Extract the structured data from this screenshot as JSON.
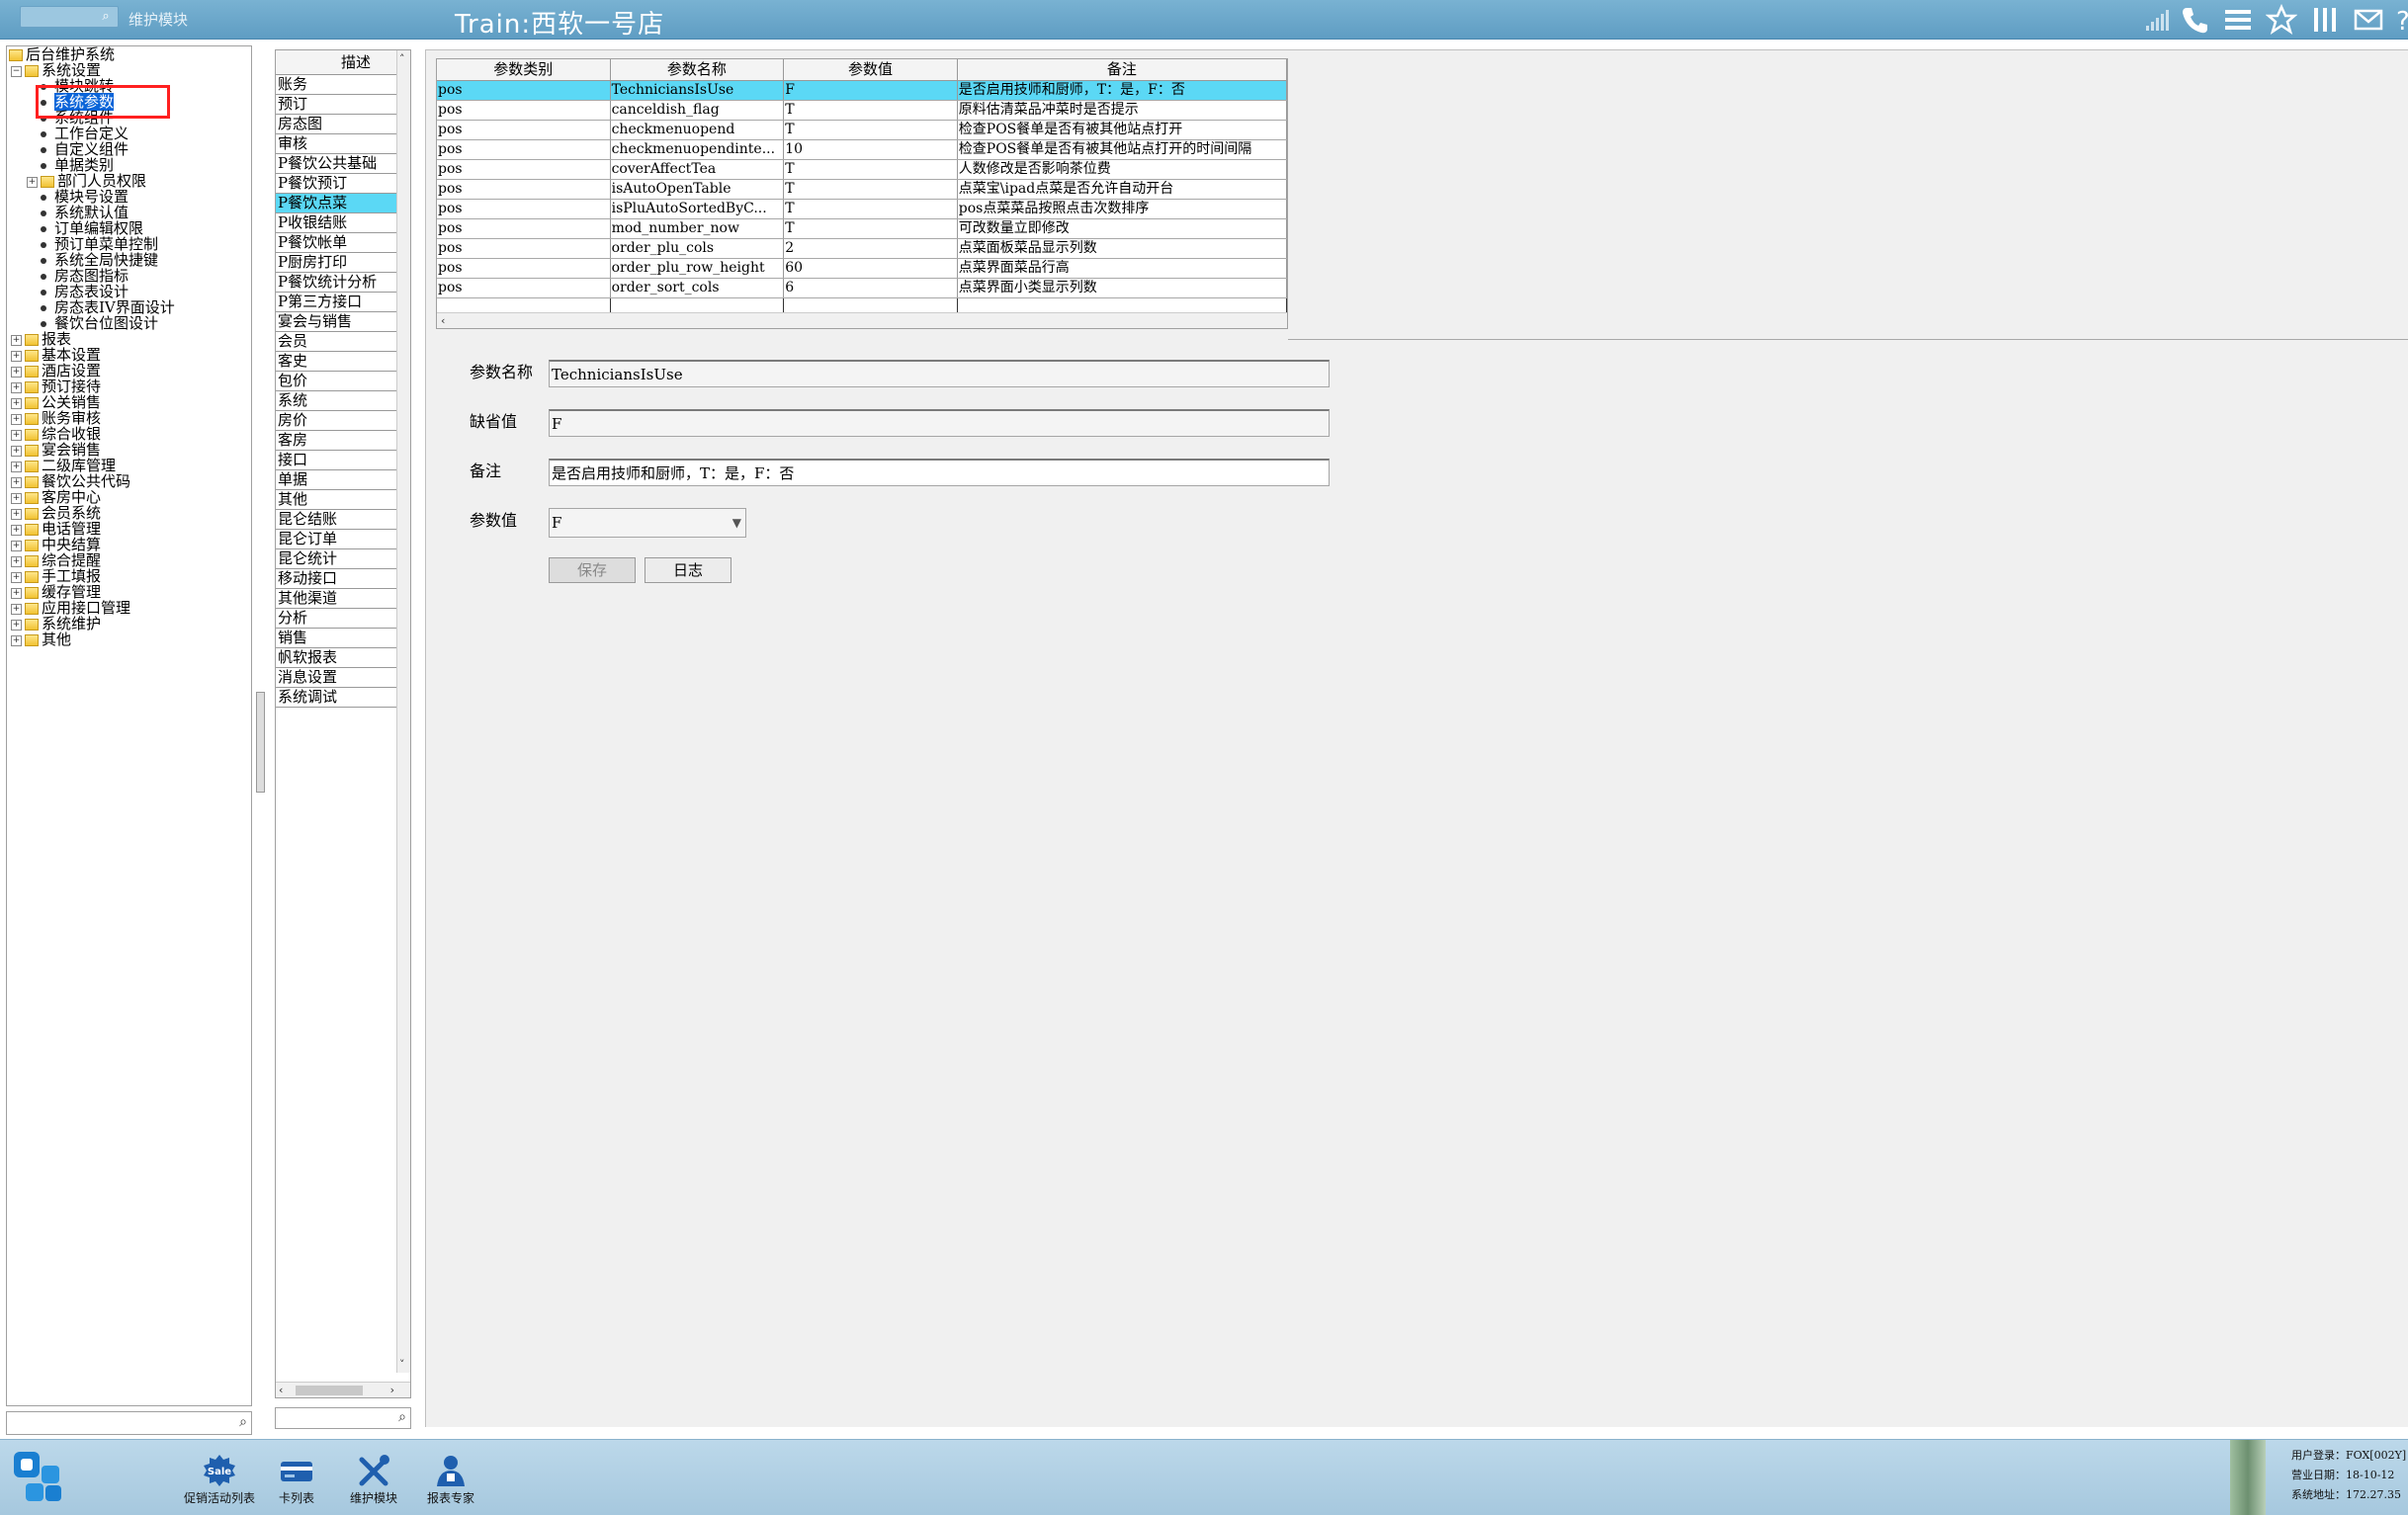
{
  "topbar": {
    "module_label": "维护模块",
    "title": "Train:西软一号店",
    "icons": [
      "signal-icon",
      "phone-icon",
      "menu-icon",
      "star-icon",
      "columns-icon",
      "mail-icon",
      "help-icon"
    ]
  },
  "tree": {
    "root": "后台维护系统",
    "system_settings": "系统设置",
    "children": [
      {
        "label": "模块跳转"
      },
      {
        "label": "系统参数",
        "selected": true
      },
      {
        "label": "系统组件"
      },
      {
        "label": "工作台定义"
      },
      {
        "label": "自定义组件"
      },
      {
        "label": "单据类别"
      },
      {
        "label": "部门人员权限",
        "folder": true
      },
      {
        "label": "模块号设置"
      },
      {
        "label": "系统默认值"
      },
      {
        "label": "订单编辑权限"
      },
      {
        "label": "预订单菜单控制"
      },
      {
        "label": "系统全局快捷键"
      },
      {
        "label": "房态图指标"
      },
      {
        "label": "房态表设计"
      },
      {
        "label": "房态表IV界面设计"
      },
      {
        "label": "餐饮台位图设计"
      }
    ],
    "top_level": [
      "报表",
      "基本设置",
      "酒店设置",
      "预订接待",
      "公关销售",
      "账务审核",
      "综合收银",
      "宴会销售",
      "二级库管理",
      "餐饮公共代码",
      "客房中心",
      "会员系统",
      "电话管理",
      "中央结算",
      "综合提醒",
      "手工填报",
      "缓存管理",
      "应用接口管理",
      "系统维护",
      "其他"
    ]
  },
  "desc_list": {
    "header": "描述",
    "items": [
      "账务",
      "预订",
      "房态图",
      "审核",
      "P餐饮公共基础",
      "P餐饮预订",
      "P餐饮点菜",
      "P收银结账",
      "P餐饮帐单",
      "P厨房打印",
      "P餐饮统计分析",
      "P第三方接口",
      "宴会与销售",
      "会员",
      "客史",
      "包价",
      "系统",
      "房价",
      "客房",
      "接口",
      "单据",
      "其他",
      "昆仑结账",
      "昆仑订单",
      "昆仑统计",
      "移动接口",
      "其他渠道",
      "分析",
      "销售",
      "帆软报表",
      "消息设置",
      "系统调试"
    ],
    "selected_index": 6
  },
  "grid": {
    "columns": [
      "参数类别",
      "参数名称",
      "参数值",
      "备注"
    ],
    "rows": [
      [
        "pos",
        "TechniciansIsUse",
        "F",
        "是否启用技师和厨师，T：是，F：否"
      ],
      [
        "pos",
        "canceldish_flag",
        "T",
        "原料估清菜品冲菜时是否提示"
      ],
      [
        "pos",
        "checkmenuopend",
        "T",
        "检查POS餐单是否有被其他站点打开"
      ],
      [
        "pos",
        "checkmenuopendinte...",
        "10",
        "检查POS餐单是否有被其他站点打开的时间间隔"
      ],
      [
        "pos",
        "coverAffectTea",
        "T",
        "人数修改是否影响茶位费"
      ],
      [
        "pos",
        "isAutoOpenTable",
        "T",
        "点菜宝\\ipad点菜是否允许自动开台"
      ],
      [
        "pos",
        "isPluAutoSortedByC...",
        "T",
        "pos点菜菜品按照点击次数排序"
      ],
      [
        "pos",
        "mod_number_now",
        "T",
        "可改数量立即修改"
      ],
      [
        "pos",
        "order_plu_cols",
        "2",
        "点菜面板菜品显示列数"
      ],
      [
        "pos",
        "order_plu_row_height",
        "60",
        "点菜界面菜品行高"
      ],
      [
        "pos",
        "order_sort_cols",
        "6",
        "点菜界面小类显示列数"
      ]
    ],
    "selected_row": 0
  },
  "form": {
    "name_label": "参数名称",
    "name_value": "TechniciansIsUse",
    "default_label": "缺省值",
    "default_value": "F",
    "remark_label": "备注",
    "remark_value": "是否启用技师和厨师，T：是，F：否",
    "param_label": "参数值",
    "param_value": "F",
    "save_label": "保存",
    "log_label": "日志"
  },
  "taskbar": {
    "items": [
      {
        "label": "促销活动列表",
        "icon": "sale-icon"
      },
      {
        "label": "卡列表",
        "icon": "card-icon"
      },
      {
        "label": "维护模块",
        "icon": "tools-icon"
      },
      {
        "label": "报表专家",
        "icon": "report-expert-icon"
      }
    ],
    "sale_badge": "Sale",
    "status": {
      "user": "用户登录：FOX[002Y]",
      "date": "营业日期：18-10-12",
      "addr": "系统地址：172.27.35"
    }
  },
  "colors": {
    "accent": "#5f9dc3",
    "selection": "#5bd8f5",
    "tree_selection": "#0a64d8",
    "annotation": "#ff2020"
  }
}
